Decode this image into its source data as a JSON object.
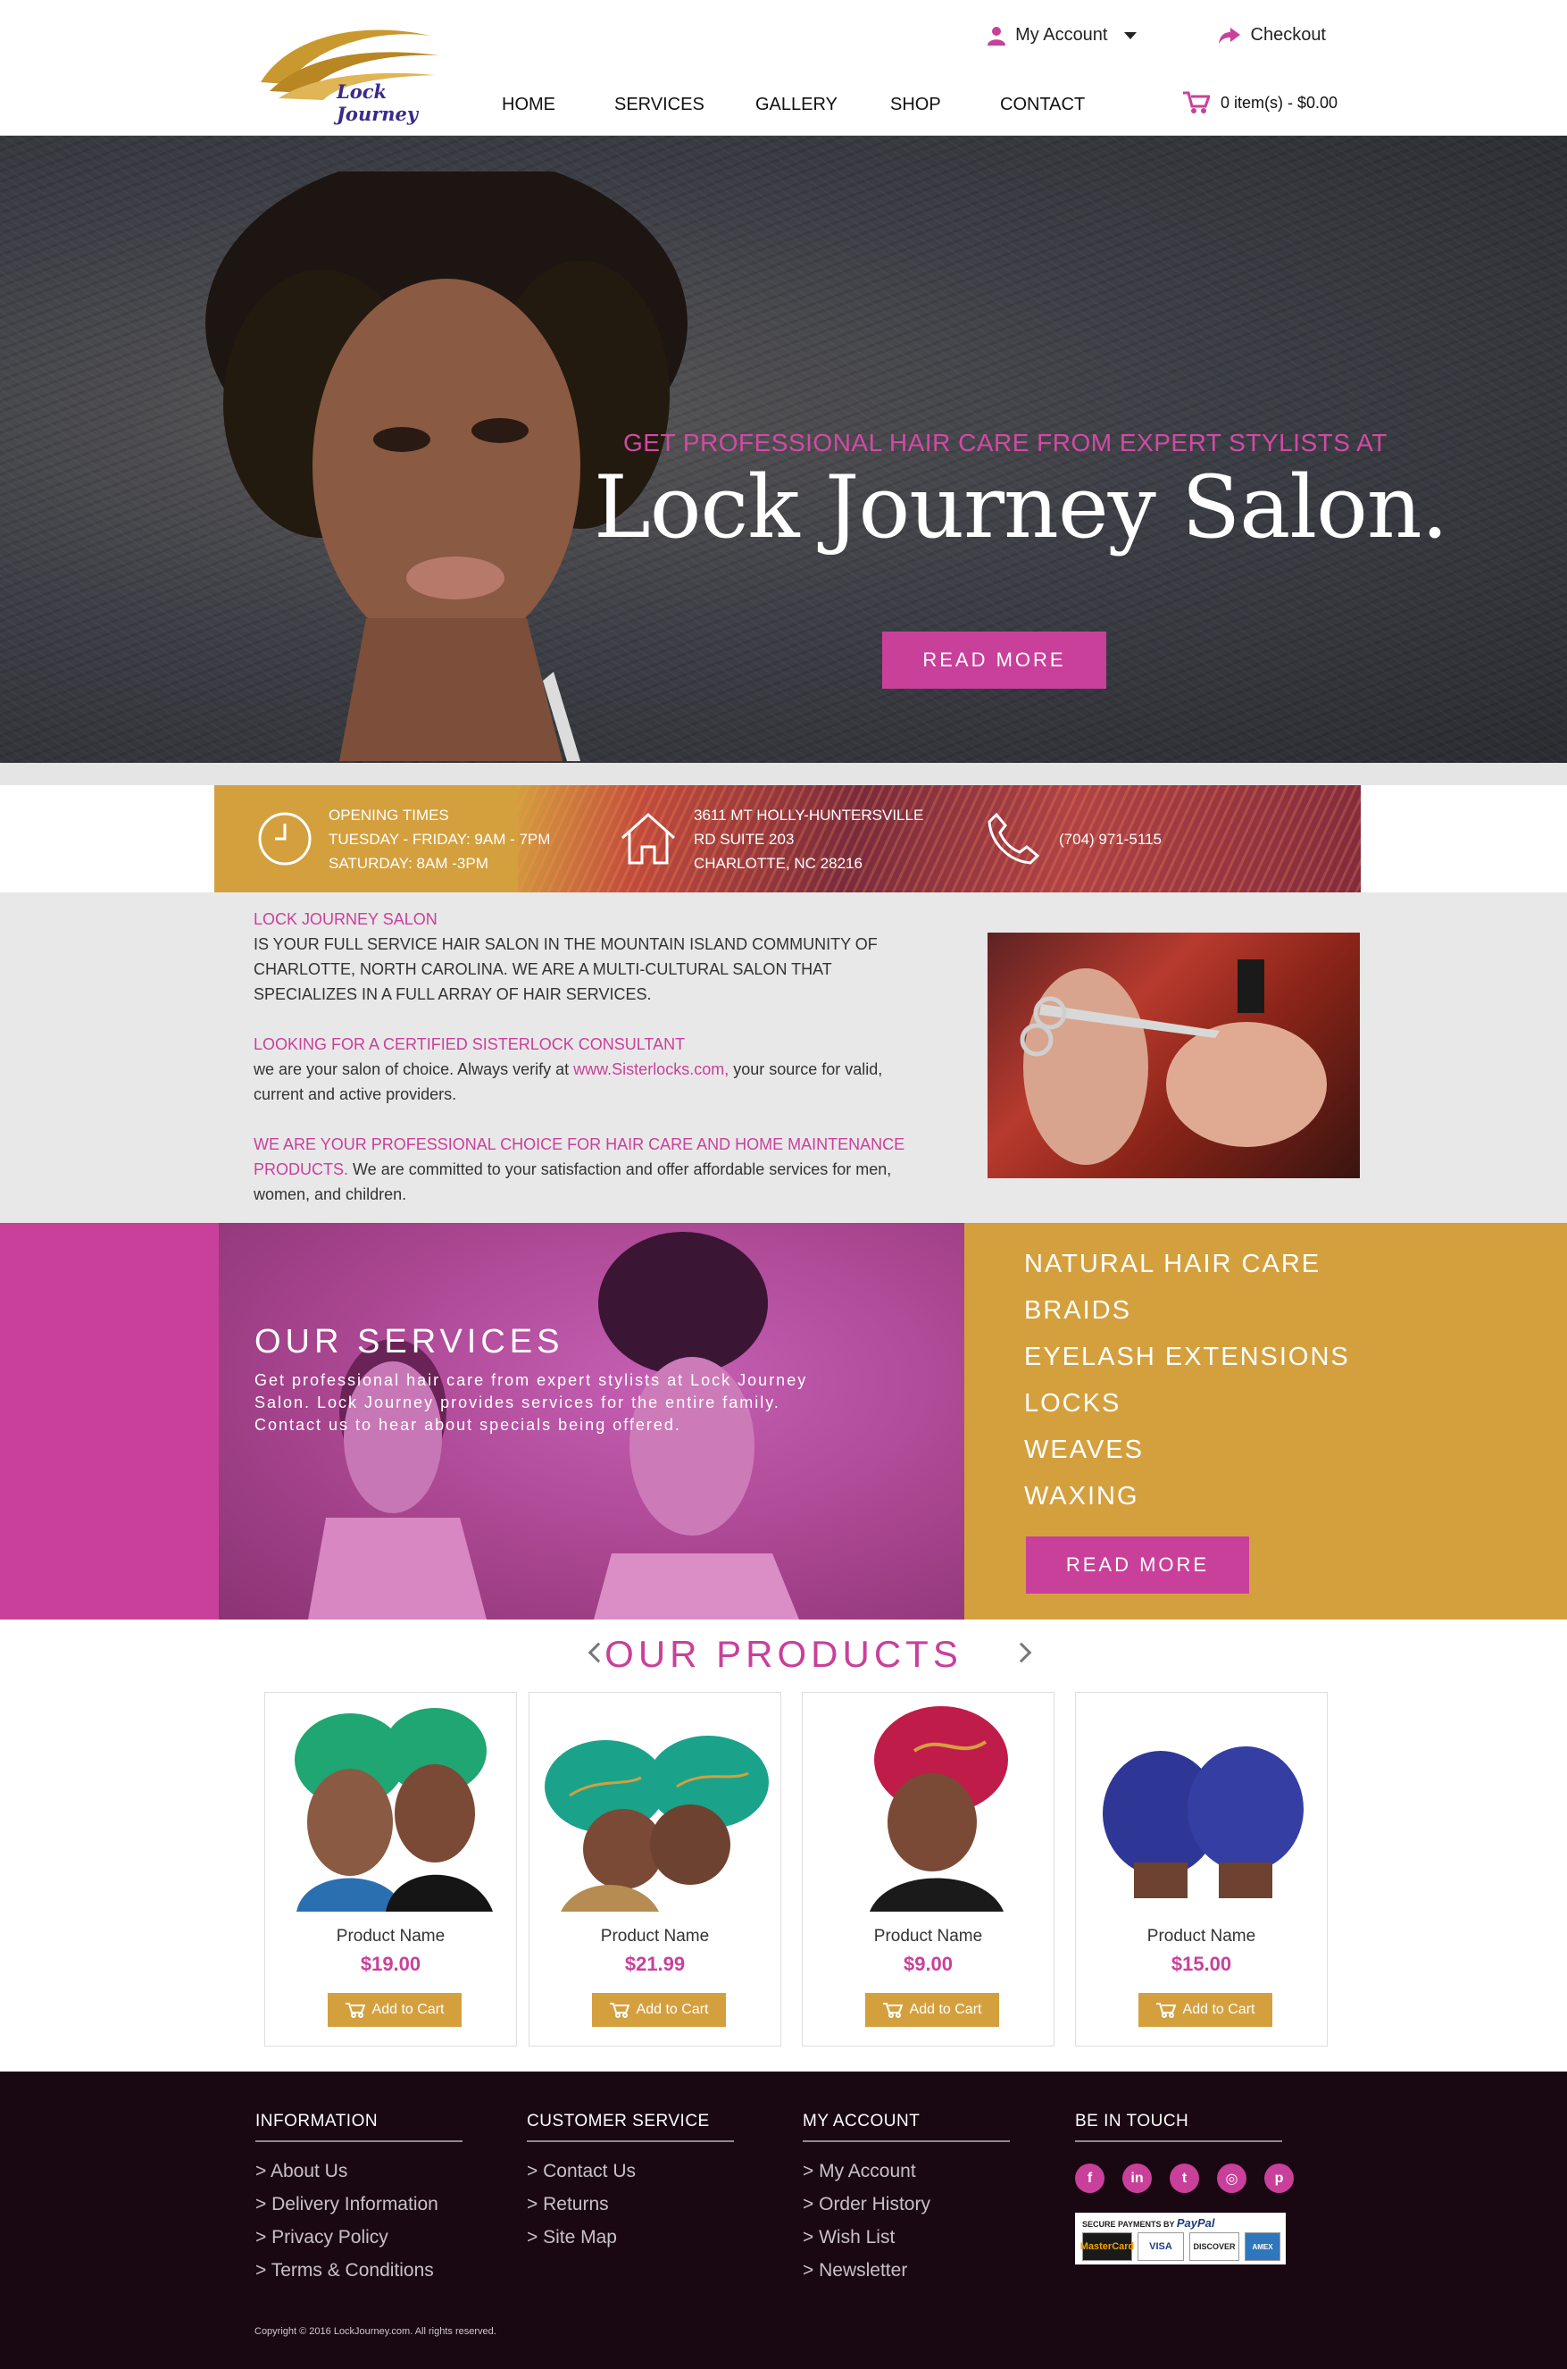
{
  "brand": {
    "logo_text": "Lock Journey"
  },
  "header": {
    "my_account": "My Account",
    "checkout": "Checkout",
    "cart": "0 item(s) - $0.00",
    "nav": [
      "HOME",
      "SERVICES",
      "GALLERY",
      "SHOP",
      "CONTACT"
    ]
  },
  "hero": {
    "subtitle": "GET PROFESSIONAL HAIR CARE FROM EXPERT STYLISTS AT",
    "title": "Lock Journey Salon.",
    "button": "READ MORE"
  },
  "info": {
    "hours_title": "OPENING TIMES",
    "hours_line1": "TUESDAY - FRIDAY: 9AM - 7PM",
    "hours_line2": "SATURDAY: 8AM -3PM",
    "addr_line1": "3611 MT HOLLY-HUNTERSVILLE",
    "addr_line2": "RD SUITE 203",
    "addr_line3": "CHARLOTTE, NC 28216",
    "phone": "(704) 971-5115"
  },
  "about": {
    "p1_title": "LOCK JOURNEY SALON",
    "p1_body": "IS YOUR FULL SERVICE HAIR SALON IN THE MOUNTAIN ISLAND COMMUNITY OF CHARLOTTE, NORTH CAROLINA.  WE ARE A MULTI-CULTURAL SALON THAT SPECIALIZES IN A FULL ARRAY OF HAIR SERVICES.",
    "p2_title": "LOOKING FOR A CERTIFIED SISTERLOCK CONSULTANT",
    "p2_body_a": "we are your salon of choice.  Always verify at ",
    "p2_link": "www.Sisterlocks.com,",
    "p2_body_b": " your source for valid, current and active providers.",
    "p3_title": "WE ARE YOUR PROFESSIONAL CHOICE FOR HAIR CARE AND HOME MAINTENANCE PRODUCTS.",
    "p3_body": " We are committed to your satisfaction and offer affordable services for men, women, and children."
  },
  "services": {
    "title": "OUR SERVICES",
    "description": "Get professional hair care from expert stylists at Lock Journey Salon. Lock Journey provides services for the entire family.  Contact us to hear about specials being offered.",
    "list": [
      "NATURAL HAIR CARE",
      "BRAIDS",
      "EYELASH EXTENSIONS",
      "LOCKS",
      "WEAVES",
      "WAXING"
    ],
    "button": "READ MORE"
  },
  "products": {
    "title": "OUR PRODUCTS",
    "items": [
      {
        "name": "Product Name",
        "price": "$19.00",
        "button": "Add to Cart",
        "color": "#1fa672"
      },
      {
        "name": "Product Name",
        "price": "$21.99",
        "button": "Add to Cart",
        "color": "#1aa38a"
      },
      {
        "name": "Product Name",
        "price": "$9.00",
        "button": "Add to Cart",
        "color": "#c01c4a"
      },
      {
        "name": "Product Name",
        "price": "$15.00",
        "button": "Add to Cart",
        "color": "#2f3796"
      }
    ]
  },
  "footer": {
    "information": {
      "title": "INFORMATION",
      "links": [
        "About Us",
        "Delivery Information",
        "Privacy Policy",
        "Terms & Conditions"
      ]
    },
    "customer_service": {
      "title": "CUSTOMER SERVICE",
      "links": [
        "Contact Us",
        "Returns",
        "Site Map"
      ]
    },
    "my_account": {
      "title": "MY ACCOUNT",
      "links": [
        "My Account",
        "Order History",
        "Wish List",
        "Newsletter"
      ]
    },
    "touch": {
      "title": "BE IN TOUCH"
    },
    "social_icons": [
      "facebook-icon",
      "linkedin-icon",
      "twitter-icon",
      "instagram-icon",
      "pinterest-icon"
    ],
    "payment_label": "SECURE PAYMENTS BY",
    "payment_brand": "PayPal",
    "cards": [
      "MasterCard",
      "VISA",
      "DISCOVER",
      "AMEX"
    ],
    "copyright": "Copyright © 2016 LockJourney.com. All rights reserved."
  },
  "colors": {
    "pink": "#c9409b",
    "gold": "#d4a03e",
    "footer": "#190712"
  }
}
